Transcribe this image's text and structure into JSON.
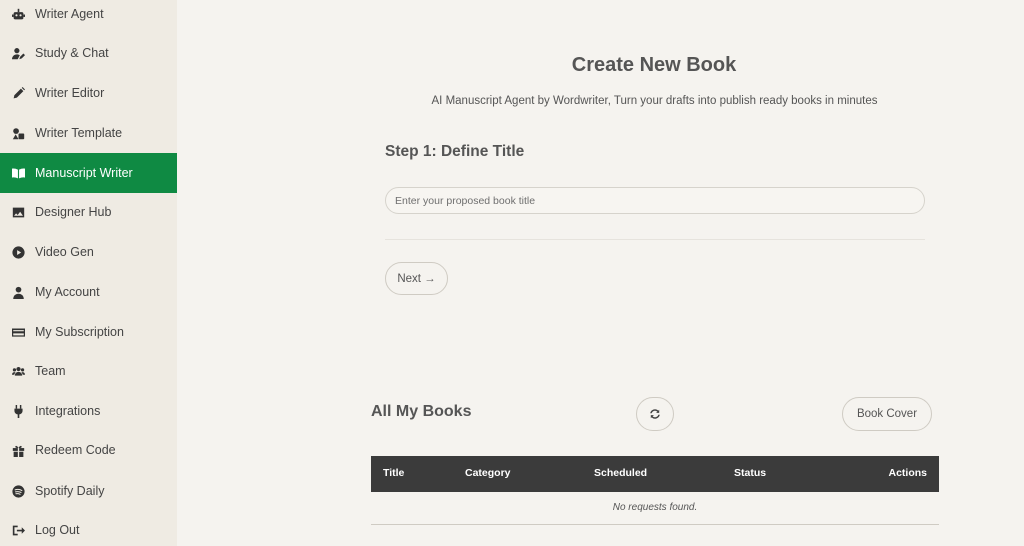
{
  "sidebar": {
    "items": [
      {
        "label": "Writer Agent",
        "icon": "robot-icon"
      },
      {
        "label": "Study & Chat",
        "icon": "user-pen-icon"
      },
      {
        "label": "Writer Editor",
        "icon": "pencil-icon"
      },
      {
        "label": "Writer Template",
        "icon": "shapes-icon"
      },
      {
        "label": "Manuscript Writer",
        "icon": "book-open-icon",
        "active": true
      },
      {
        "label": "Designer Hub",
        "icon": "image-icon"
      },
      {
        "label": "Video Gen",
        "icon": "play-circle-icon"
      },
      {
        "label": "My Account",
        "icon": "user-icon"
      },
      {
        "label": "My Subscription",
        "icon": "credit-card-icon"
      },
      {
        "label": "Team",
        "icon": "users-icon"
      },
      {
        "label": "Integrations",
        "icon": "plug-icon"
      },
      {
        "label": "Redeem Code",
        "icon": "gift-icon"
      },
      {
        "label": "Spotify Daily",
        "icon": "spotify-icon"
      },
      {
        "label": "Log Out",
        "icon": "logout-icon"
      }
    ],
    "active_color": "#0f8a43"
  },
  "main": {
    "title": "Create New Book",
    "subtitle": "AI Manuscript Agent by Wordwriter, Turn your drafts into publish ready books in minutes",
    "step_title": "Step 1: Define Title",
    "title_input": {
      "value": "",
      "placeholder": "Enter your proposed book title"
    },
    "next_label": "Next →"
  },
  "books": {
    "title": "All My Books",
    "refresh_icon": "refresh-icon",
    "book_cover_label": "Book Cover",
    "columns": [
      "Title",
      "Category",
      "Scheduled",
      "Status",
      "Actions"
    ],
    "empty_message": "No requests found."
  }
}
